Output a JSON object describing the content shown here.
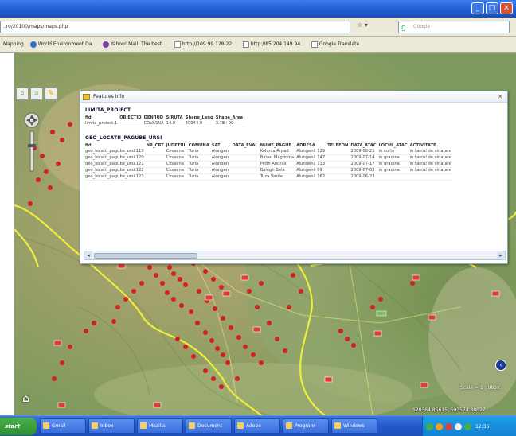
{
  "browser": {
    "window_buttons": {
      "minimize": "_",
      "maximize": "□",
      "close": "×"
    },
    "address": "..ro/20100/maps/maps.php",
    "search_placeholder": "Google",
    "bookmarks": [
      "Mapping",
      "World Environment Da...",
      "Yahoo! Mail: The best ...",
      "http://109.99.128.22...",
      "http://85.204.149.94...",
      "Google Translate"
    ]
  },
  "popup": {
    "title": "Features Info",
    "close": "×",
    "layer1": {
      "name": "LIMITA_PROIECT",
      "columns": [
        "fid",
        "OBJECTID",
        "DEN/JUD",
        "SIRUTA",
        "Shape_Leng",
        "Shape_Area"
      ],
      "rows": [
        [
          "limita_proiect.1",
          "",
          "COVASNA",
          "14.0",
          "40044.0",
          "3.7E+09"
        ]
      ]
    },
    "layer2": {
      "name": "GEO_LOCATII_PAGUBE_URSI",
      "columns": [
        "fid",
        "NR_CRT",
        "JUDETUL",
        "COMUNA",
        "SAT",
        "DATA_EVAL",
        "NUME_PAGUB",
        "ADRESA",
        "TELEFON",
        "DATA_ATAC",
        "LOCUL_ATAC",
        "ACTIVITATE"
      ],
      "rows": [
        [
          "geo_locatii_pagube_ursi.119",
          "",
          "Covasna",
          "Turia",
          "Alungeni",
          "",
          "Kolonia Arpad",
          "Alungeni, 129",
          "",
          "2009-08-21",
          "in curte",
          "in tarcul de vinatare"
        ],
        [
          "geo_locatii_pagube_ursi.120",
          "",
          "Covasna",
          "Turia",
          "Alungeni",
          "",
          "Balasi Magdolna",
          "Alungeni, 147",
          "",
          "2009-07-14",
          "in gradina",
          "in tarcul de vinatare"
        ],
        [
          "geo_locatii_pagube_ursi.121",
          "",
          "Covasna",
          "Turia",
          "Alungeni",
          "",
          "Piroh Andras",
          "Alungeni, 133",
          "",
          "2009-07-17",
          "in gradina",
          "in tarcul de vinatare"
        ],
        [
          "geo_locatii_pagube_ursi.122",
          "",
          "Covasna",
          "Turia",
          "Alungeni",
          "",
          "Balogh Bela",
          "Alungeni, 99",
          "",
          "2009-07-02",
          "in gradina",
          "in tarcul de vinatare"
        ],
        [
          "geo_locatii_pagube_ursi.123",
          "",
          "Covasna",
          "Turia",
          "Alungeni",
          "",
          "Tuza Vasile",
          "Alungeni, 162",
          "",
          "2009-06-23",
          "",
          ""
        ]
      ]
    }
  },
  "map": {
    "scale": "Scale = 1 : 983K",
    "coords": "520364.85615, 593574.88027"
  },
  "taskbar": {
    "start": "start",
    "tasks": [
      "Gmail",
      "Inbox",
      "Mozilla",
      "Document",
      "Adobe",
      "Program",
      "Windows"
    ],
    "clock": "12:35"
  }
}
